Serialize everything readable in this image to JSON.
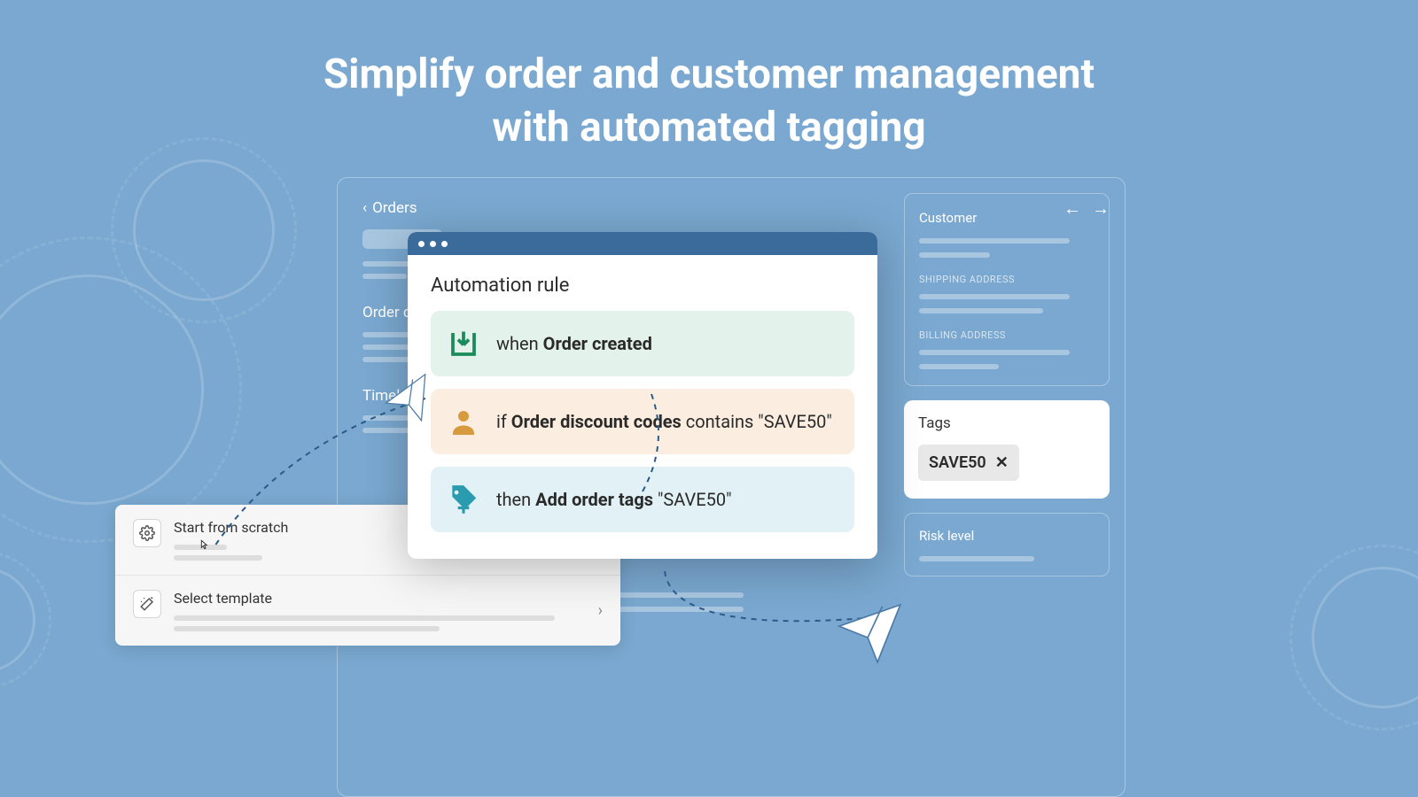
{
  "hero": {
    "line1": "Simplify order and customer management",
    "line2": "with automated tagging"
  },
  "breadcrumb": {
    "back_label": "Orders"
  },
  "left_sections": {
    "order": "Order d",
    "timeline": "Timel"
  },
  "right_panel": {
    "customer": "Customer",
    "shipping": "SHIPPING ADDRESS",
    "billing": "BILLING ADDRESS",
    "risk": "Risk level"
  },
  "tags_card": {
    "title": "Tags",
    "tag_value": "SAVE50"
  },
  "picker": {
    "scratch": "Start from scratch",
    "template": "Select template"
  },
  "automation": {
    "title": "Automation rule",
    "when_prefix": "when ",
    "when_bold": "Order created",
    "if_prefix": "if ",
    "if_bold": "Order discount codes",
    "if_suffix": " contains \"SAVE50\"",
    "then_prefix": "then ",
    "then_bold": "Add order tags",
    "then_suffix": " \"SAVE50\""
  }
}
